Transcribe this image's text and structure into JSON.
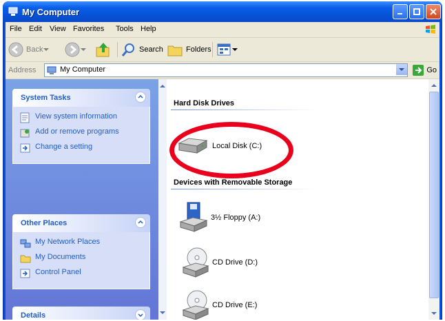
{
  "window": {
    "title": "My Computer",
    "controls": {
      "minimize": "minimize",
      "maximize": "maximize",
      "close": "close"
    }
  },
  "menu": [
    "File",
    "Edit",
    "View",
    "Favorites",
    "Tools",
    "Help"
  ],
  "toolbar": {
    "back": "Back",
    "search": "Search",
    "folders": "Folders"
  },
  "address": {
    "label": "Address",
    "value": "My Computer",
    "go": "Go"
  },
  "left_panels": {
    "system_tasks": {
      "title": "System Tasks",
      "items": [
        "View system information",
        "Add or remove programs",
        "Change a setting"
      ]
    },
    "other_places": {
      "title": "Other Places",
      "items": [
        "My Network Places",
        "My Documents",
        "Control Panel"
      ]
    },
    "details": {
      "title": "Details"
    }
  },
  "content": {
    "groups": [
      {
        "title": "Hard Disk Drives",
        "items": [
          "Local Disk (C:)"
        ]
      },
      {
        "title": "Devices with Removable Storage",
        "items": [
          "3½ Floppy (A:)",
          "CD Drive (D:)",
          "CD Drive (E:)"
        ]
      }
    ]
  },
  "colors": {
    "titlebar_blue": "#0a5ee8",
    "task_link": "#215dc6",
    "callout_red": "#e8001c"
  }
}
